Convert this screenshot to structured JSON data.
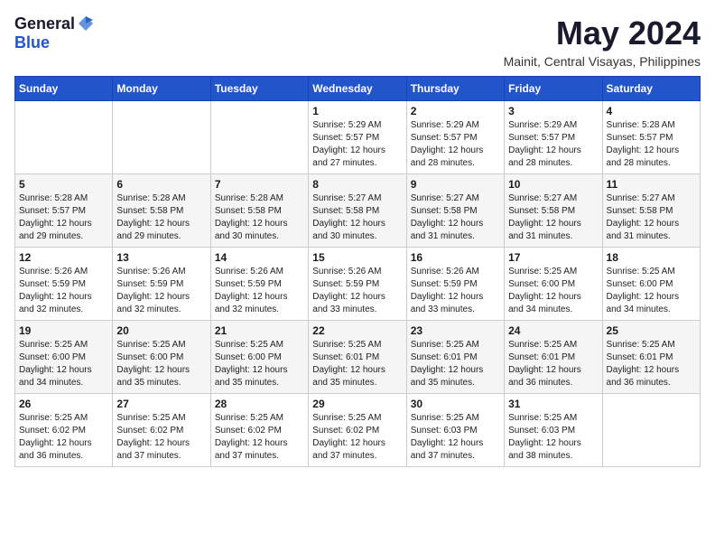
{
  "header": {
    "logo_general": "General",
    "logo_blue": "Blue",
    "month": "May 2024",
    "location": "Mainit, Central Visayas, Philippines"
  },
  "weekdays": [
    "Sunday",
    "Monday",
    "Tuesday",
    "Wednesday",
    "Thursday",
    "Friday",
    "Saturday"
  ],
  "weeks": [
    [
      {
        "day": "",
        "sunrise": "",
        "sunset": "",
        "daylight": ""
      },
      {
        "day": "",
        "sunrise": "",
        "sunset": "",
        "daylight": ""
      },
      {
        "day": "",
        "sunrise": "",
        "sunset": "",
        "daylight": ""
      },
      {
        "day": "1",
        "sunrise": "Sunrise: 5:29 AM",
        "sunset": "Sunset: 5:57 PM",
        "daylight": "Daylight: 12 hours and 27 minutes."
      },
      {
        "day": "2",
        "sunrise": "Sunrise: 5:29 AM",
        "sunset": "Sunset: 5:57 PM",
        "daylight": "Daylight: 12 hours and 28 minutes."
      },
      {
        "day": "3",
        "sunrise": "Sunrise: 5:29 AM",
        "sunset": "Sunset: 5:57 PM",
        "daylight": "Daylight: 12 hours and 28 minutes."
      },
      {
        "day": "4",
        "sunrise": "Sunrise: 5:28 AM",
        "sunset": "Sunset: 5:57 PM",
        "daylight": "Daylight: 12 hours and 28 minutes."
      }
    ],
    [
      {
        "day": "5",
        "sunrise": "Sunrise: 5:28 AM",
        "sunset": "Sunset: 5:57 PM",
        "daylight": "Daylight: 12 hours and 29 minutes."
      },
      {
        "day": "6",
        "sunrise": "Sunrise: 5:28 AM",
        "sunset": "Sunset: 5:58 PM",
        "daylight": "Daylight: 12 hours and 29 minutes."
      },
      {
        "day": "7",
        "sunrise": "Sunrise: 5:28 AM",
        "sunset": "Sunset: 5:58 PM",
        "daylight": "Daylight: 12 hours and 30 minutes."
      },
      {
        "day": "8",
        "sunrise": "Sunrise: 5:27 AM",
        "sunset": "Sunset: 5:58 PM",
        "daylight": "Daylight: 12 hours and 30 minutes."
      },
      {
        "day": "9",
        "sunrise": "Sunrise: 5:27 AM",
        "sunset": "Sunset: 5:58 PM",
        "daylight": "Daylight: 12 hours and 31 minutes."
      },
      {
        "day": "10",
        "sunrise": "Sunrise: 5:27 AM",
        "sunset": "Sunset: 5:58 PM",
        "daylight": "Daylight: 12 hours and 31 minutes."
      },
      {
        "day": "11",
        "sunrise": "Sunrise: 5:27 AM",
        "sunset": "Sunset: 5:58 PM",
        "daylight": "Daylight: 12 hours and 31 minutes."
      }
    ],
    [
      {
        "day": "12",
        "sunrise": "Sunrise: 5:26 AM",
        "sunset": "Sunset: 5:59 PM",
        "daylight": "Daylight: 12 hours and 32 minutes."
      },
      {
        "day": "13",
        "sunrise": "Sunrise: 5:26 AM",
        "sunset": "Sunset: 5:59 PM",
        "daylight": "Daylight: 12 hours and 32 minutes."
      },
      {
        "day": "14",
        "sunrise": "Sunrise: 5:26 AM",
        "sunset": "Sunset: 5:59 PM",
        "daylight": "Daylight: 12 hours and 32 minutes."
      },
      {
        "day": "15",
        "sunrise": "Sunrise: 5:26 AM",
        "sunset": "Sunset: 5:59 PM",
        "daylight": "Daylight: 12 hours and 33 minutes."
      },
      {
        "day": "16",
        "sunrise": "Sunrise: 5:26 AM",
        "sunset": "Sunset: 5:59 PM",
        "daylight": "Daylight: 12 hours and 33 minutes."
      },
      {
        "day": "17",
        "sunrise": "Sunrise: 5:25 AM",
        "sunset": "Sunset: 6:00 PM",
        "daylight": "Daylight: 12 hours and 34 minutes."
      },
      {
        "day": "18",
        "sunrise": "Sunrise: 5:25 AM",
        "sunset": "Sunset: 6:00 PM",
        "daylight": "Daylight: 12 hours and 34 minutes."
      }
    ],
    [
      {
        "day": "19",
        "sunrise": "Sunrise: 5:25 AM",
        "sunset": "Sunset: 6:00 PM",
        "daylight": "Daylight: 12 hours and 34 minutes."
      },
      {
        "day": "20",
        "sunrise": "Sunrise: 5:25 AM",
        "sunset": "Sunset: 6:00 PM",
        "daylight": "Daylight: 12 hours and 35 minutes."
      },
      {
        "day": "21",
        "sunrise": "Sunrise: 5:25 AM",
        "sunset": "Sunset: 6:00 PM",
        "daylight": "Daylight: 12 hours and 35 minutes."
      },
      {
        "day": "22",
        "sunrise": "Sunrise: 5:25 AM",
        "sunset": "Sunset: 6:01 PM",
        "daylight": "Daylight: 12 hours and 35 minutes."
      },
      {
        "day": "23",
        "sunrise": "Sunrise: 5:25 AM",
        "sunset": "Sunset: 6:01 PM",
        "daylight": "Daylight: 12 hours and 35 minutes."
      },
      {
        "day": "24",
        "sunrise": "Sunrise: 5:25 AM",
        "sunset": "Sunset: 6:01 PM",
        "daylight": "Daylight: 12 hours and 36 minutes."
      },
      {
        "day": "25",
        "sunrise": "Sunrise: 5:25 AM",
        "sunset": "Sunset: 6:01 PM",
        "daylight": "Daylight: 12 hours and 36 minutes."
      }
    ],
    [
      {
        "day": "26",
        "sunrise": "Sunrise: 5:25 AM",
        "sunset": "Sunset: 6:02 PM",
        "daylight": "Daylight: 12 hours and 36 minutes."
      },
      {
        "day": "27",
        "sunrise": "Sunrise: 5:25 AM",
        "sunset": "Sunset: 6:02 PM",
        "daylight": "Daylight: 12 hours and 37 minutes."
      },
      {
        "day": "28",
        "sunrise": "Sunrise: 5:25 AM",
        "sunset": "Sunset: 6:02 PM",
        "daylight": "Daylight: 12 hours and 37 minutes."
      },
      {
        "day": "29",
        "sunrise": "Sunrise: 5:25 AM",
        "sunset": "Sunset: 6:02 PM",
        "daylight": "Daylight: 12 hours and 37 minutes."
      },
      {
        "day": "30",
        "sunrise": "Sunrise: 5:25 AM",
        "sunset": "Sunset: 6:03 PM",
        "daylight": "Daylight: 12 hours and 37 minutes."
      },
      {
        "day": "31",
        "sunrise": "Sunrise: 5:25 AM",
        "sunset": "Sunset: 6:03 PM",
        "daylight": "Daylight: 12 hours and 38 minutes."
      },
      {
        "day": "",
        "sunrise": "",
        "sunset": "",
        "daylight": ""
      }
    ]
  ]
}
